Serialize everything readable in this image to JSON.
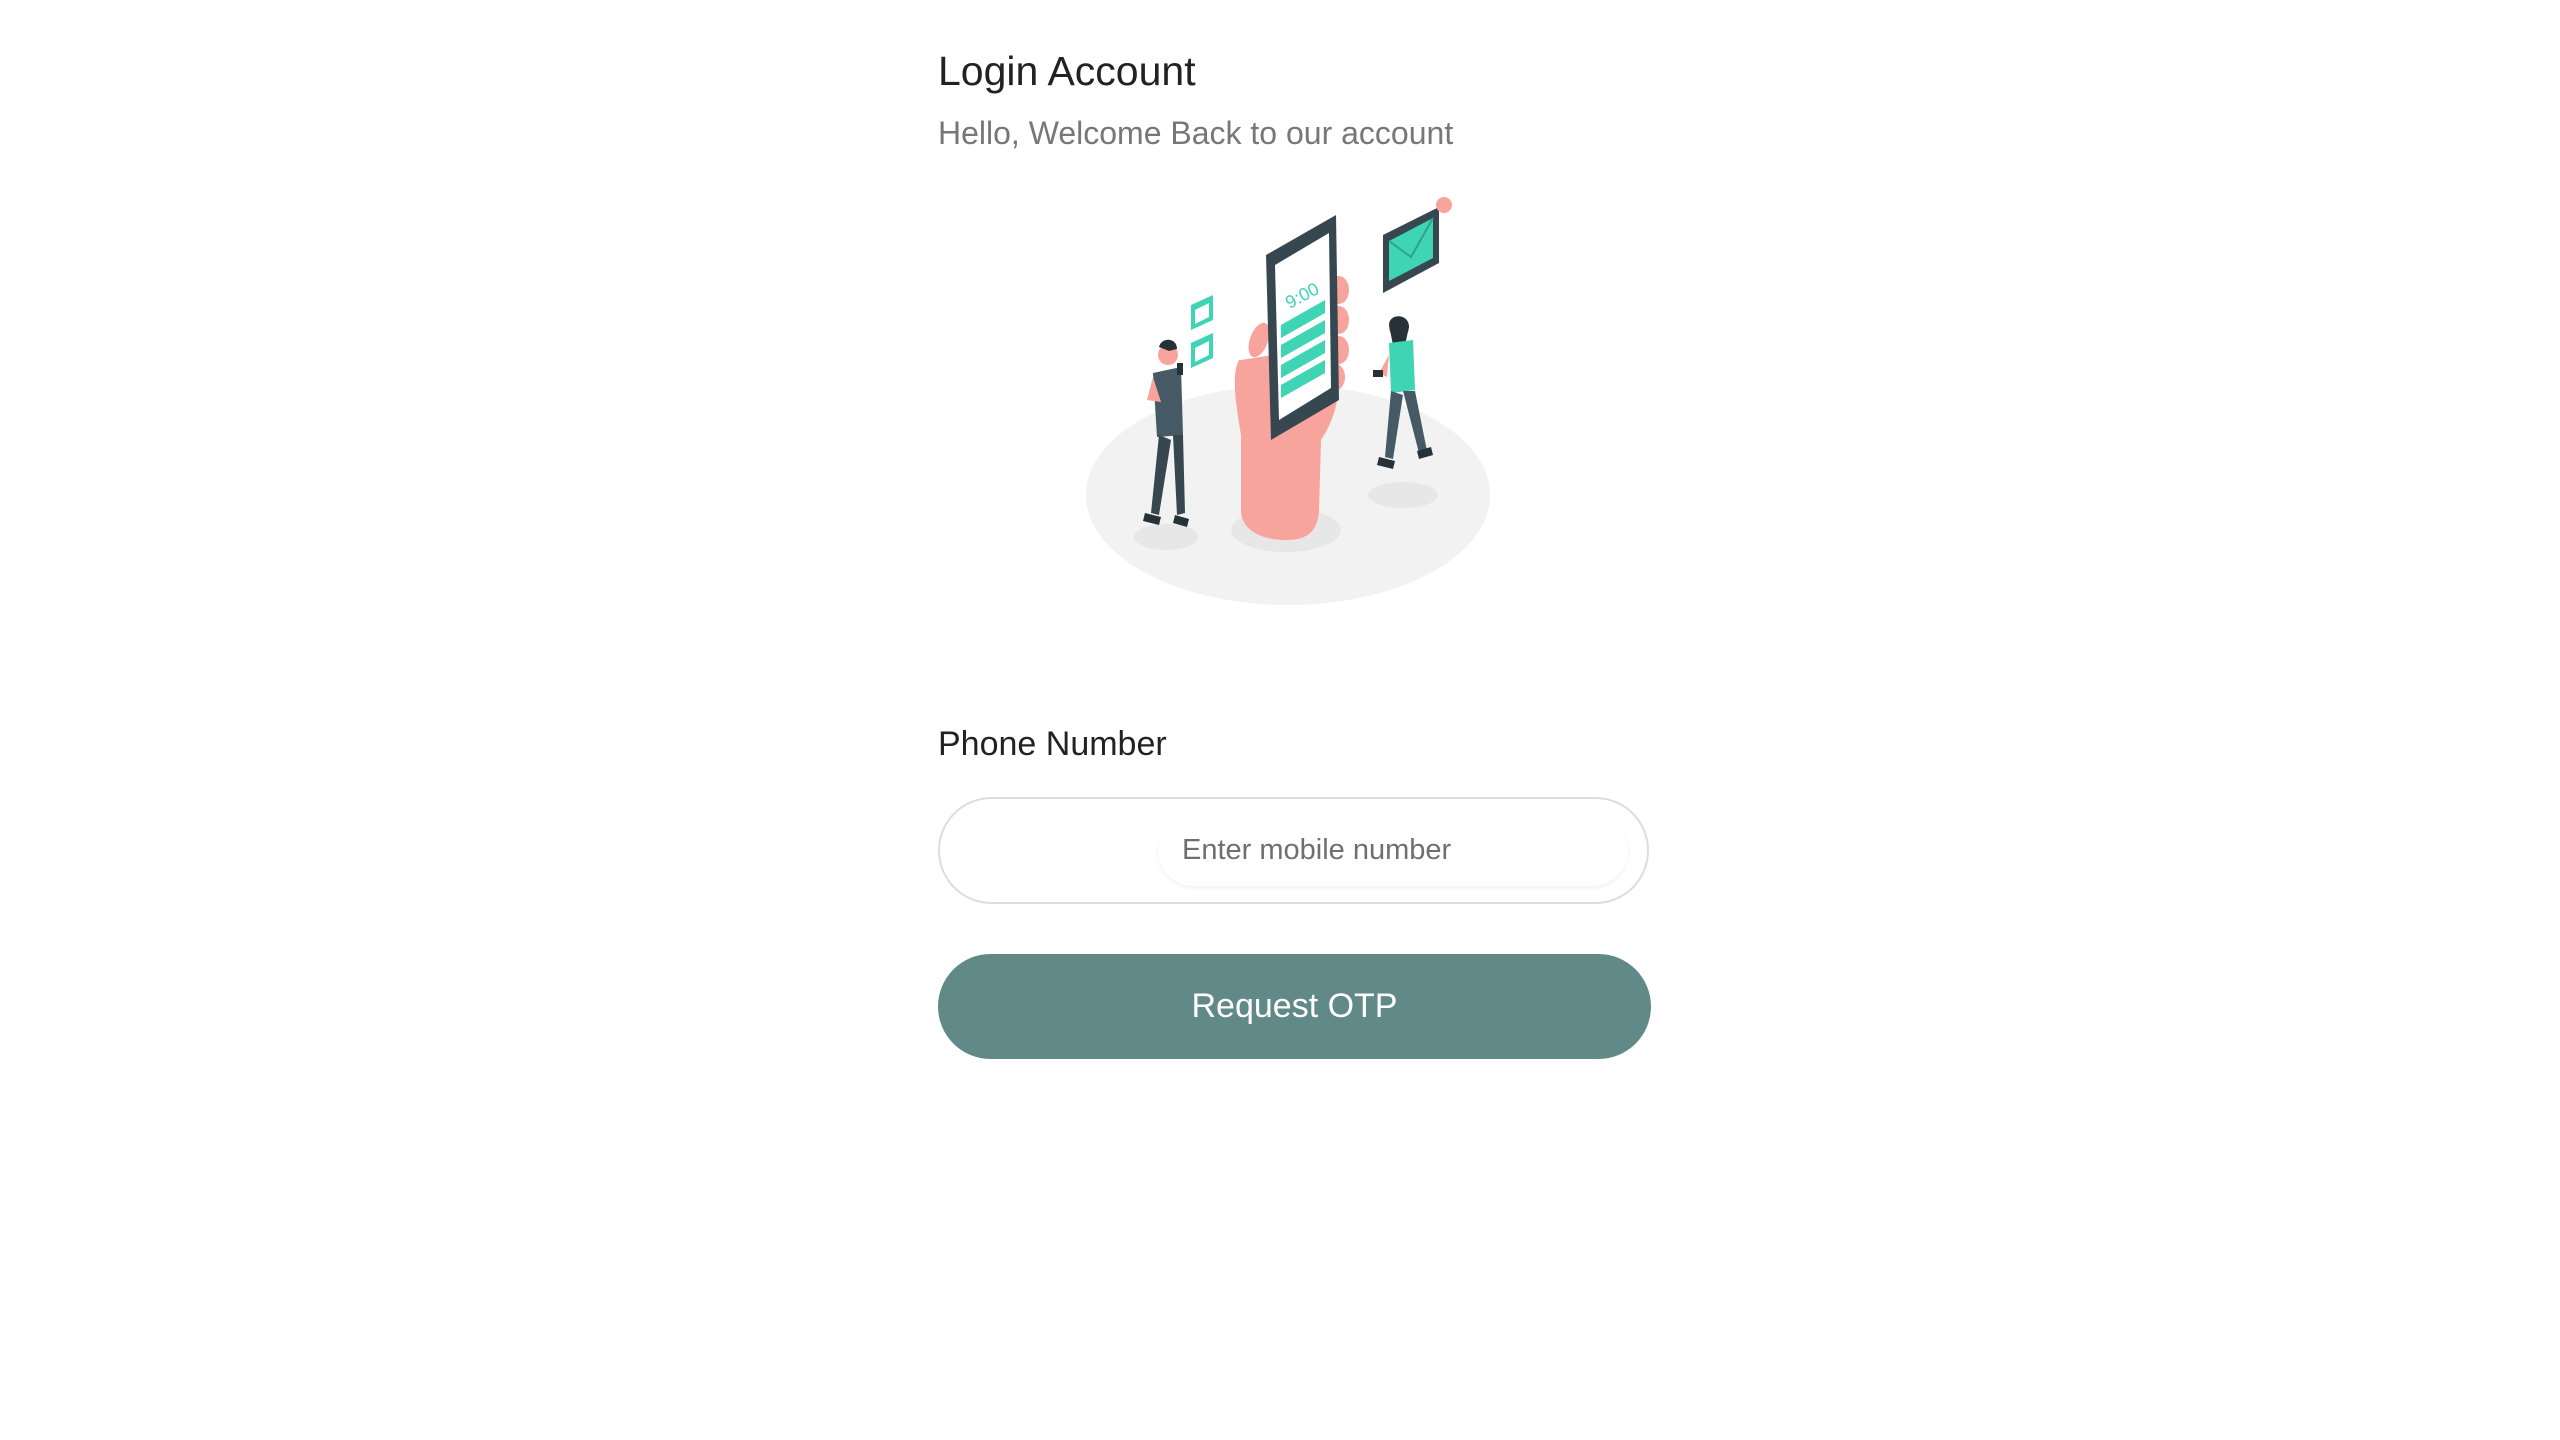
{
  "header": {
    "title": "Login Account",
    "subtitle": "Hello, Welcome Back to our account"
  },
  "illustration": {
    "name": "person-holding-phone-illustration",
    "phone_time": "9:00",
    "accent_color": "#3fd4b4",
    "skin_color": "#f7a49d",
    "dark_color": "#3a4a4e"
  },
  "form": {
    "phone_label": "Phone Number",
    "phone_placeholder": "Enter mobile number",
    "phone_value": "",
    "submit_label": "Request OTP"
  },
  "colors": {
    "button_bg": "#618987",
    "button_text": "#ffffff"
  }
}
